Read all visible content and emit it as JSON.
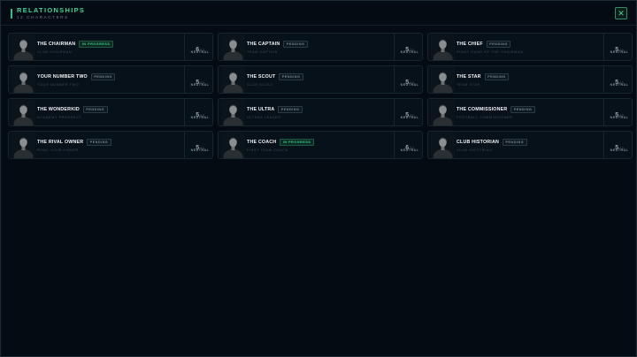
{
  "header": {
    "title": "RELATIONSHIPS",
    "subtitle": "12 CHARACTERS",
    "close_icon": "close-icon",
    "accent_color": "#43d39a"
  },
  "colors": {
    "in_progress": "#3ed497",
    "pending": "#7d8b95"
  },
  "characters": [
    {
      "name": "THE CHAIRMAN",
      "status_badge": "IN PROGRESS",
      "role": "CLUB CHAIRMAN",
      "score": "6",
      "score_max": "/10",
      "mood": "NEUTRAL"
    },
    {
      "name": "THE CAPTAIN",
      "status_badge": "PENDING",
      "role": "TEAM CAPTAIN",
      "score": "5",
      "score_max": "/10",
      "mood": "NEUTRAL"
    },
    {
      "name": "THE CHIEF",
      "status_badge": "PENDING",
      "role": "RIGHT HAND OF THE CHAIRMAN",
      "score": "5",
      "score_max": "/10",
      "mood": "NEUTRAL"
    },
    {
      "name": "YOUR NUMBER TWO",
      "status_badge": "PENDING",
      "role": "YOUR NUMBER TWO",
      "score": "5",
      "score_max": "/10",
      "mood": "NEUTRAL"
    },
    {
      "name": "THE SCOUT",
      "status_badge": "PENDING",
      "role": "CLUB SCOUT",
      "score": "5",
      "score_max": "/10",
      "mood": "NEUTRAL"
    },
    {
      "name": "THE STAR",
      "status_badge": "PENDING",
      "role": "TEAM STAR",
      "score": "5",
      "score_max": "/10",
      "mood": "NEUTRAL"
    },
    {
      "name": "THE WONDERKID",
      "status_badge": "PENDING",
      "role": "ACADEMY PROSPECT",
      "score": "5",
      "score_max": "/10",
      "mood": "NEUTRAL"
    },
    {
      "name": "THE ULTRA",
      "status_badge": "PENDING",
      "role": "ULTRAS LEADER",
      "score": "5",
      "score_max": "/10",
      "mood": "NEUTRAL"
    },
    {
      "name": "THE COMMISSIONER",
      "status_badge": "PENDING",
      "role": "FOOTBALL COMMISSIONER",
      "score": "5",
      "score_max": "/10",
      "mood": "NEUTRAL"
    },
    {
      "name": "THE RIVAL OWNER",
      "status_badge": "PENDING",
      "role": "RIVAL CLUB OWNER",
      "score": "5",
      "score_max": "/10",
      "mood": "NEUTRAL"
    },
    {
      "name": "THE COACH",
      "status_badge": "IN PROGRESS",
      "role": "FIRST TEAM COACH",
      "score": "6",
      "score_max": "/10",
      "mood": "NEUTRAL"
    },
    {
      "name": "CLUB HISTORIAN",
      "status_badge": "PENDING",
      "role": "CLUB HISTORIAN",
      "score": "5",
      "score_max": "/10",
      "mood": "NEUTRAL"
    }
  ]
}
